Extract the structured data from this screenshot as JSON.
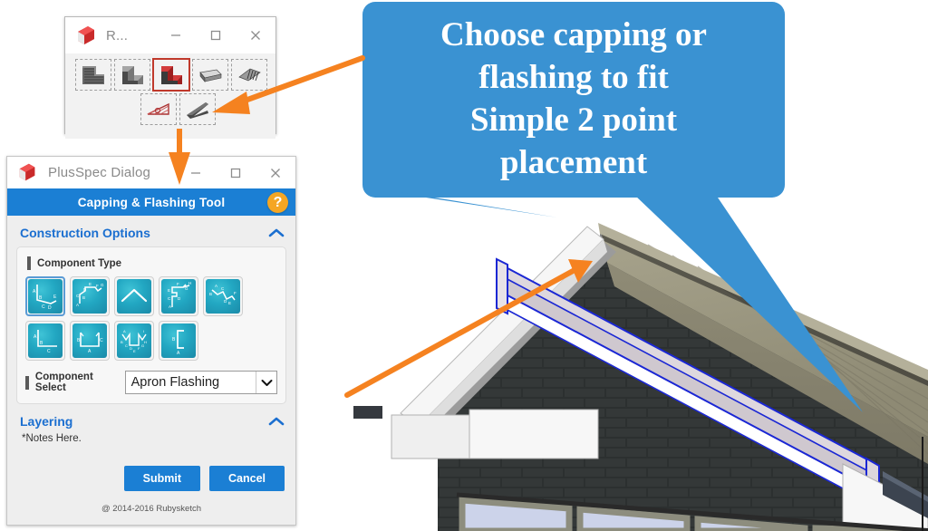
{
  "toolbar_window": {
    "title": "R...",
    "app_icon": "sketchup-icon",
    "controls": {
      "minimize": "minimize-icon",
      "maximize": "maximize-icon",
      "close": "close-icon"
    },
    "tools_row1": [
      {
        "name": "corner-capping-tool",
        "selected": false
      },
      {
        "name": "corner-flashing-tool",
        "selected": false
      },
      {
        "name": "capping-flashing-tool",
        "selected": true
      },
      {
        "name": "roof-sheet-tool",
        "selected": false
      },
      {
        "name": "roof-batten-tool",
        "selected": false
      }
    ],
    "tools_row2": [
      {
        "name": "truss-tool",
        "selected": false
      },
      {
        "name": "flashing-blade-tool",
        "selected": false
      }
    ]
  },
  "dialog": {
    "window_title": "PlusSpec Dialog",
    "app_icon": "sketchup-icon",
    "controls": {
      "minimize": "minimize-icon",
      "maximize": "maximize-icon",
      "close": "close-icon"
    },
    "banner_title": "Capping & Flashing Tool",
    "help_label": "?",
    "sections": {
      "construction": {
        "title": "Construction Options",
        "chevron": "chevron-up-icon",
        "component_type_label": "Component Type",
        "component_type_tiles": [
          {
            "name": "apron-flashing-profile",
            "selected": true
          },
          {
            "name": "stepped-flashing-profile",
            "selected": false
          },
          {
            "name": "ridge-capping-profile",
            "selected": false
          },
          {
            "name": "parapet-capping-profile",
            "selected": false
          },
          {
            "name": "valley-flashing-profile",
            "selected": false
          },
          {
            "name": "angle-flashing-profile",
            "selected": false
          },
          {
            "name": "box-gutter-profile",
            "selected": false
          },
          {
            "name": "barge-capping-profile",
            "selected": false
          },
          {
            "name": "channel-flashing-profile",
            "selected": false
          }
        ],
        "component_select_label": "Component Select",
        "component_select_value": "Apron Flashing",
        "component_select_caret": "chevron-down-icon"
      },
      "layering": {
        "title": "Layering",
        "chevron": "chevron-up-icon",
        "notes": "*Notes Here."
      }
    },
    "submit_label": "Submit",
    "cancel_label": "Cancel",
    "copyright": "@ 2014-2016 Rubysketch"
  },
  "callout": {
    "lines": [
      "Choose capping or",
      "flashing to fit",
      "Simple 2 point",
      "placement"
    ],
    "text": "Choose capping or flashing to fit Simple 2 point placement",
    "background": "#3a92d2",
    "text_color": "#ffffff"
  },
  "annotations": {
    "arrow_color": "#f58220",
    "pointer_color": "#3a92d2",
    "arrows": [
      {
        "name": "arrow-to-toolbar-tool",
        "from": "callout-left-edge",
        "to": "flashing-blade-tool"
      },
      {
        "name": "arrow-to-dialog-banner",
        "from": "flashing-blade-tool",
        "to": "dialog-banner"
      },
      {
        "name": "arrow-to-roof-flashing",
        "from": "submit-button",
        "to": "roof-flashing-component"
      }
    ],
    "tails": [
      {
        "name": "callout-tail-ridge",
        "to": "roof-ridge-flashing-start"
      },
      {
        "name": "callout-tail-eave",
        "to": "roof-eave-flashing-end"
      }
    ]
  },
  "scene": {
    "name": "sketchup-3d-model-viewport",
    "description": "3D gable end of a house with dark brick wall, olive metal roof, white barge board and a blue-highlighted flashing component",
    "colors": {
      "brick": "#2b2f2f",
      "brick_mortar": "#9aa0a0",
      "roof": "#9d9983",
      "roof_shadow": "#8b8773",
      "barge_white": "#f4f4f4",
      "flashing_highlight": "#1b27d4",
      "flashing_face": "#cfc8cf",
      "glass": "#ccd3ea",
      "frame": "#8d8d7e",
      "gutter": "#3a4250"
    }
  }
}
